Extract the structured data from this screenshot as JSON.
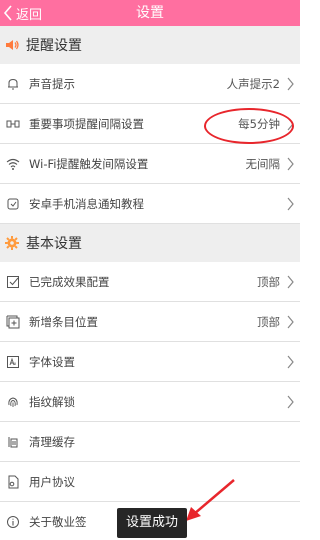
{
  "header": {
    "back_label": "返回",
    "title": "设置"
  },
  "sections": {
    "reminder": {
      "title": "提醒设置",
      "icon": "speaker-icon",
      "color": "#ff7a3c"
    },
    "basic": {
      "title": "基本设置",
      "icon": "gear-icon",
      "color": "#ff9a3c"
    }
  },
  "rows": {
    "sound": {
      "label": "声音提示",
      "value": "人声提示2",
      "icon": "bell-icon"
    },
    "interval": {
      "label": "重要事项提醒间隔设置",
      "value": "每5分钟",
      "icon": "interval-icon"
    },
    "wifi": {
      "label": "Wi-Fi提醒触发间隔设置",
      "value": "无间隔",
      "icon": "wifi-icon"
    },
    "android": {
      "label": "安卓手机消息通知教程",
      "value": "",
      "icon": "android-icon"
    },
    "completed": {
      "label": "已完成效果配置",
      "value": "顶部",
      "icon": "checkbox-icon"
    },
    "newitem": {
      "label": "新增条目位置",
      "value": "顶部",
      "icon": "add-item-icon"
    },
    "font": {
      "label": "字体设置",
      "value": "",
      "icon": "font-icon"
    },
    "fingerprint": {
      "label": "指纹解锁",
      "value": "",
      "icon": "fingerprint-icon"
    },
    "cache": {
      "label": "清理缓存",
      "value": "",
      "icon": "clean-icon"
    },
    "agreement": {
      "label": "用户协议",
      "value": "",
      "icon": "document-icon"
    },
    "about": {
      "label": "关于敬业签",
      "value": "",
      "icon": "info-icon"
    }
  },
  "toast": {
    "text": "设置成功"
  },
  "colors": {
    "brand": "#ff6fa0",
    "annotation": "#e8262c"
  }
}
